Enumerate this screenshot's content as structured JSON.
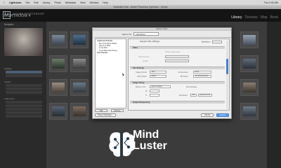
{
  "menubar": {
    "app": "Lightroom",
    "items": [
      "File",
      "Edit",
      "Library",
      "Photo",
      "Metadata",
      "View",
      "Window",
      "Help"
    ],
    "clock": "Thu 9:40 AM"
  },
  "window": {
    "title": "Illustration.lrcat - Adobe Photoshop Lightroom - Library"
  },
  "header": {
    "product": "ADOBE PHOTOSHOP",
    "app_name": "LIGHTROOM 4",
    "modules": [
      "Library",
      "Develop",
      "Map",
      "Book"
    ],
    "active_module": "Library"
  },
  "left_panel": {
    "navigator": "Navigator",
    "catalog": "Catalog",
    "folders": "Folders",
    "collections": "Collections",
    "selected_item": "All Photographs"
  },
  "dialog": {
    "title": "Export 4 Files",
    "export_to_label": "Export To:",
    "export_to_value": "Hard Drive",
    "presets_header": "Lightroom Presets",
    "presets": [
      "Burn Full-Sized JPEGs",
      "Export to DNG",
      "For E-Mail",
      "For E-Mail (Hard Drive)",
      "User Presets"
    ],
    "add_button": "Add",
    "remove_button": "Remove",
    "example_label": "Example:",
    "example_value": "IMG_0000.jpg",
    "extensions_label": "Extensions:",
    "extensions_value": "Lowercase",
    "video_section": "Video",
    "include_video": "Include Video Files",
    "video_format_label": "Video Format:",
    "quality_label": "Quality:",
    "file_settings_section": "File Settings",
    "image_format_label": "Image Format:",
    "image_format_value": "TIFF",
    "compression_label": "Compression:",
    "compression_value": "None",
    "color_space_label": "Color Space:",
    "color_space_value": "sRGB",
    "bit_depth_label": "Bit Depth:",
    "bit_depth_value": "16 bits/component",
    "image_sizing_section": "Image Sizing",
    "resize_label": "Resize to Fit:",
    "resize_value": "Width & Height",
    "dont_enlarge": "Don't Enlarge",
    "w_label": "W:",
    "h_label": "H:",
    "resolution_label": "Resolution:",
    "resolution_value": "240",
    "resolution_unit": "pixels per inch",
    "sharpening_section": "Output Sharpening",
    "plugin_manager_button": "Plug-in Manager...",
    "cancel_button": "Cancel",
    "export_button": "Export"
  },
  "watermark": {
    "line1": "Mind",
    "line2": "Luster"
  },
  "colors": {
    "accent": "#5b9cf0",
    "panel": "#2a2a2a",
    "grid": "#3b3b3b"
  }
}
